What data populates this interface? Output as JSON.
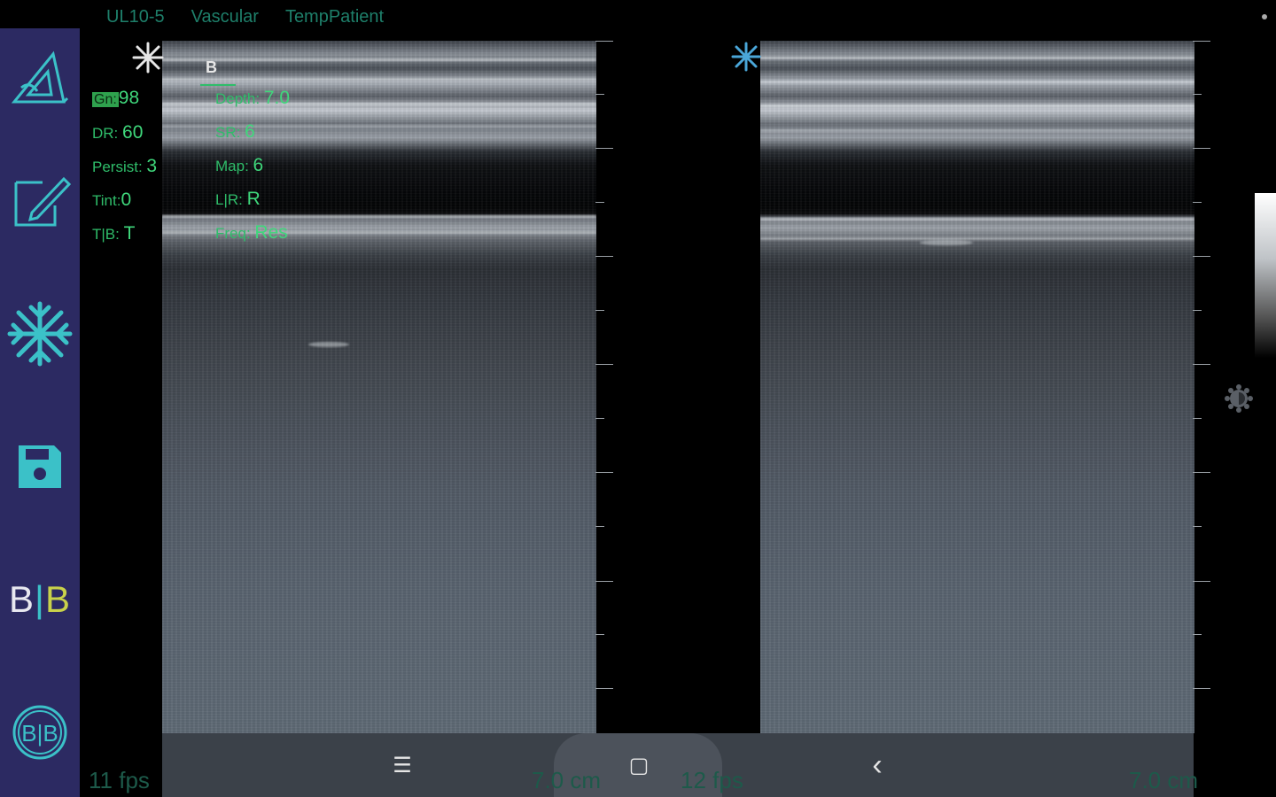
{
  "header": {
    "probe": "UL10-5",
    "preset": "Vascular",
    "patient": "TempPatient"
  },
  "sidebar": {
    "items": [
      {
        "name": "measure",
        "icon": "measure-triangle-icon"
      },
      {
        "name": "annotate",
        "icon": "edit-note-icon"
      },
      {
        "name": "freeze",
        "icon": "snowflake-icon"
      },
      {
        "name": "save",
        "icon": "floppy-save-icon"
      },
      {
        "name": "dual-b",
        "label_b1": "B",
        "label_sep": "|",
        "label_b2": "B"
      },
      {
        "name": "dual-b-circle",
        "label": "B|B"
      }
    ]
  },
  "params_left": {
    "gn_label": "Gn:",
    "gn_value": "98",
    "dr_label": "DR:",
    "dr_value": "60",
    "persist_label": "Persist:",
    "persist_value": "3",
    "tint_label": "Tint:",
    "tint_value": "0",
    "tb_label": "T|B:",
    "tb_value": "T"
  },
  "params_right": {
    "mode": "B",
    "depth_label": "Depth:",
    "depth_value": "7.0",
    "sn_label": "SR:",
    "sn_value": "6",
    "map_label": "Map:",
    "map_value": "6",
    "lr_label": "L|R:",
    "lr_value": "R",
    "freq_label": "Freq:",
    "freq_value": "Res"
  },
  "bottom": {
    "fps_left": "11 fps",
    "depth_left": "7.0 cm",
    "fps_right": "12 fps",
    "depth_right": "7.0 cm",
    "nav_menu": "☰",
    "nav_home": "▢",
    "nav_back": "‹"
  },
  "colors": {
    "sidebar": "#2c2a62",
    "accent_teal": "#3bc1c8",
    "param_green": "#2fbd6a"
  }
}
